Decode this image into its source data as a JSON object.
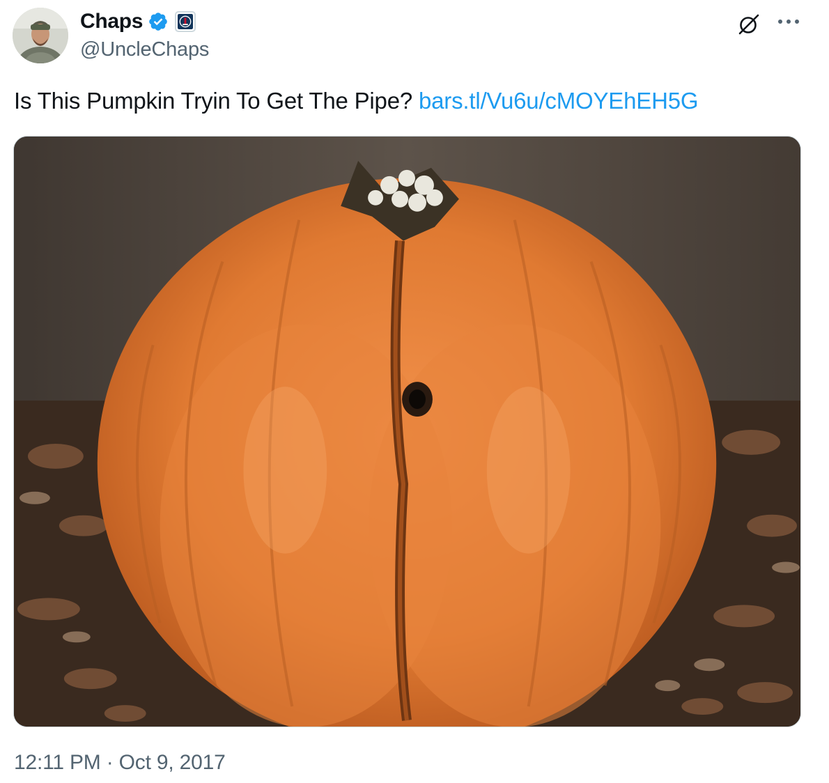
{
  "author": {
    "display_name": "Chaps",
    "handle": "@UncleChaps",
    "verified": true,
    "verified_icon": "verified-badge-icon",
    "affiliate_icon": "barstool-affiliate-icon",
    "avatar_icon": "profile-avatar"
  },
  "header_actions": {
    "grok_icon": "grok-icon",
    "more_icon": "more-options-icon"
  },
  "tweet": {
    "text": "Is This Pumpkin Tryin To Get The Pipe?",
    "link_text": "bars.tl/Vu6u/cMOYEhEH5G"
  },
  "media": {
    "type": "photo",
    "subject": "pumpkin-photo"
  },
  "meta": {
    "time": "12:11 PM",
    "separator": "·",
    "date": "Oct 9, 2017"
  },
  "colors": {
    "link": "#1d9bf0",
    "secondary_text": "#536471",
    "verified_blue": "#1d9bf0",
    "pumpkin_orange": "#e07a32"
  }
}
